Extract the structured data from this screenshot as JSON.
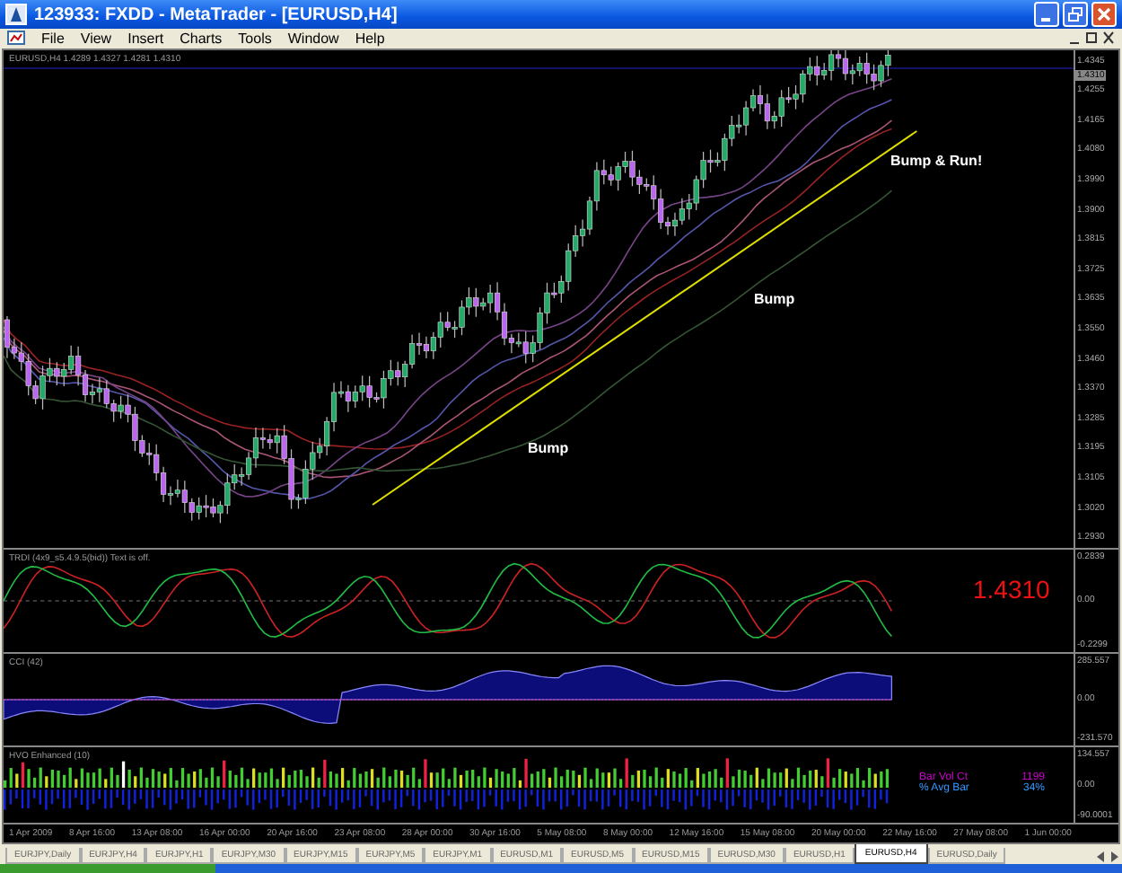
{
  "window": {
    "title": "123933: FXDD - MetaTrader - [EURUSD,H4]"
  },
  "menu": [
    "File",
    "View",
    "Insert",
    "Charts",
    "Tools",
    "Window",
    "Help"
  ],
  "chart": {
    "header": "EURUSD,H4  1.4289 1.4327 1.4281 1.4310",
    "current_price": "1.4310",
    "price_scale": [
      "1.4345",
      "1.4255",
      "1.4165",
      "1.4080",
      "1.3990",
      "1.3900",
      "1.3815",
      "1.3725",
      "1.3635",
      "1.3550",
      "1.3460",
      "1.3370",
      "1.3285",
      "1.3195",
      "1.3105",
      "1.3020",
      "1.2930"
    ],
    "annotations": [
      "Bump",
      "Bump",
      "Bump & Run!"
    ]
  },
  "indicators": [
    {
      "kind": "oscillator",
      "title": "TRDI (4x9_s5.4.9.5(bid))  Text is off.",
      "scale": [
        "0.2839",
        "0.00",
        "-0.2299"
      ],
      "value": "1.4310"
    },
    {
      "kind": "area",
      "title": "CCI (42)",
      "scale": [
        "285.557",
        "0.00",
        "-231.570"
      ]
    },
    {
      "kind": "histogram",
      "title": "HVO Enhanced (10)",
      "scale": [
        "134.557",
        "0.00",
        "-90.0001"
      ],
      "stats": [
        {
          "label": "Bar Vol Ct",
          "value": "1199",
          "color": "#cc00cc"
        },
        {
          "label": "% Avg Bar",
          "value": "34%",
          "color": "#3399ff"
        }
      ]
    }
  ],
  "time_axis": [
    "1 Apr 2009",
    "8 Apr 16:00",
    "13 Apr 08:00",
    "16 Apr 00:00",
    "20 Apr 16:00",
    "23 Apr 08:00",
    "28 Apr 00:00",
    "30 Apr 16:00",
    "5 May 08:00",
    "8 May 00:00",
    "12 May 16:00",
    "15 May 08:00",
    "20 May 00:00",
    "22 May 16:00",
    "27 May 08:00",
    "1 Jun 00:00"
  ],
  "tabs": [
    {
      "label": "EURJPY,Daily",
      "selected": false
    },
    {
      "label": "EURJPY,H4",
      "selected": false
    },
    {
      "label": "EURJPY,H1",
      "selected": false
    },
    {
      "label": "EURJPY,M30",
      "selected": false
    },
    {
      "label": "EURJPY,M15",
      "selected": false
    },
    {
      "label": "EURJPY,M5",
      "selected": false
    },
    {
      "label": "EURJPY,M1",
      "selected": false
    },
    {
      "label": "EURUSD,M1",
      "selected": false
    },
    {
      "label": "EURUSD,M5",
      "selected": false
    },
    {
      "label": "EURUSD,M15",
      "selected": false
    },
    {
      "label": "EURUSD,M30",
      "selected": false
    },
    {
      "label": "EURUSD,H1",
      "selected": false
    },
    {
      "label": "EURUSD,H4",
      "selected": true
    },
    {
      "label": "EURUSD,Daily",
      "selected": false
    }
  ]
}
